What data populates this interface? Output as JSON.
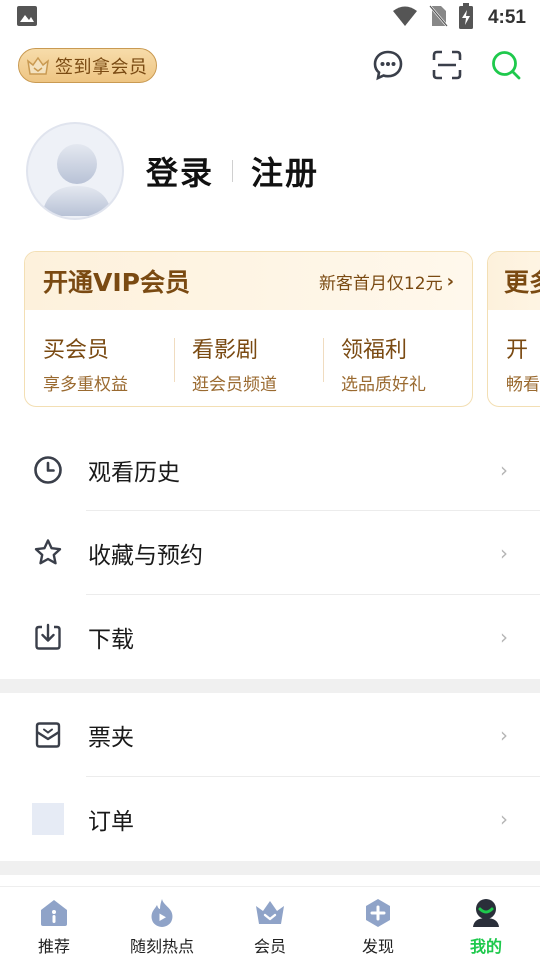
{
  "status_bar": {
    "time": "4:51"
  },
  "top_bar": {
    "checkin_label": "签到拿会员"
  },
  "profile": {
    "login": "登录",
    "register": "注册"
  },
  "vip_card": {
    "title": "开通VIP会员",
    "promo": "新客首月仅12元",
    "columns": [
      {
        "title": "买会员",
        "subtitle": "享多重权益"
      },
      {
        "title": "看影剧",
        "subtitle": "逛会员频道"
      },
      {
        "title": "领福利",
        "subtitle": "选品质好礼"
      }
    ]
  },
  "vip_card_2": {
    "title": "更多",
    "column_title": "开",
    "column_subtitle": "畅看"
  },
  "menu": {
    "group1": [
      {
        "label": "观看历史",
        "icon": "clock-icon"
      },
      {
        "label": "收藏与预约",
        "icon": "star-icon"
      },
      {
        "label": "下载",
        "icon": "download-icon"
      }
    ],
    "group2": [
      {
        "label": "票夹",
        "icon": "ticket-folder-icon"
      },
      {
        "label": "订单",
        "icon": "order-icon"
      }
    ]
  },
  "bottom_nav": [
    {
      "label": "推荐",
      "icon": "home-icon"
    },
    {
      "label": "随刻热点",
      "icon": "flame-icon"
    },
    {
      "label": "会员",
      "icon": "crown-icon"
    },
    {
      "label": "发现",
      "icon": "discover-icon"
    },
    {
      "label": "我的",
      "icon": "profile-icon",
      "active": true
    }
  ],
  "colors": {
    "accent": "#1ec94c",
    "vip_text": "#7a4a12",
    "icon_dark": "#3a3f4a",
    "icon_blue": "#8fa3c8"
  }
}
